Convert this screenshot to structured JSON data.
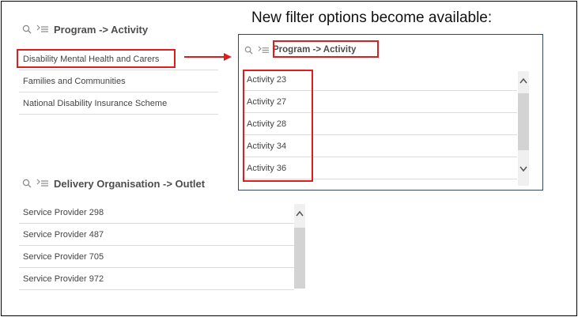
{
  "caption": "New filter options become available:",
  "program_filter": {
    "title": "Program -> Activity",
    "items": [
      "Disability Mental Health and Carers",
      "Families and Communities",
      "National Disability Insurance Scheme"
    ]
  },
  "delivery_filter": {
    "title": "Delivery Organisation -> Outlet",
    "items": [
      "Service Provider 298",
      "Service Provider 487",
      "Service Provider 705",
      "Service Provider 972"
    ]
  },
  "activity_popup": {
    "title": "Program -> Activity",
    "items": [
      "Activity 23",
      "Activity 27",
      "Activity 28",
      "Activity 34",
      "Activity 36"
    ]
  },
  "icons": {
    "search": "search-icon",
    "hierarchy": "drilldown-icon",
    "scroll_up": "chevron-up-icon",
    "scroll_down": "chevron-down-icon",
    "arrow": "arrow-right-icon"
  },
  "colors": {
    "highlight": "#e21b1b",
    "popup_border": "#2f4666"
  }
}
